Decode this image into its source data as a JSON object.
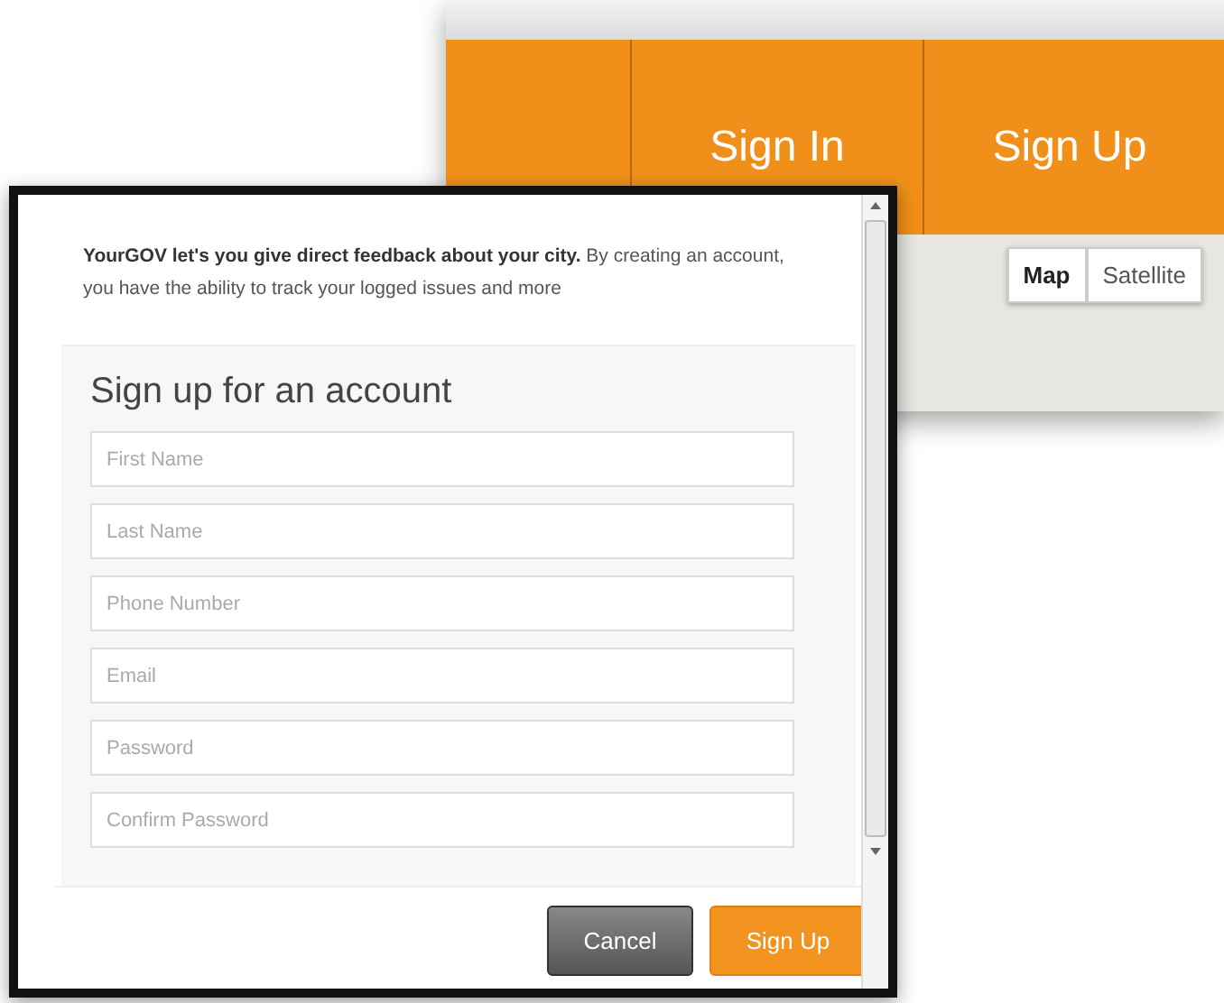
{
  "site_header": {
    "nav_items": [
      {
        "label": "Sign In"
      },
      {
        "label": "Sign Up"
      }
    ],
    "map_type": [
      {
        "label": "Map",
        "selected": true
      },
      {
        "label": "Satellite",
        "selected": false
      }
    ]
  },
  "dialog": {
    "intro": "**YourGOV let's you give direct feedback about your city.** By creating an account, you have the ability to track your logged issues and more",
    "title": "Sign up for an account",
    "fields": [
      {
        "placeholder": "First Name"
      },
      {
        "placeholder": "Last Name"
      },
      {
        "placeholder": "Phone Number"
      },
      {
        "placeholder": "Email"
      },
      {
        "placeholder": "Password"
      },
      {
        "placeholder": "Confirm Password"
      }
    ],
    "buttons": [
      {
        "label": "Cancel",
        "kind": "secondary"
      },
      {
        "label": "Sign Up",
        "kind": "primary"
      }
    ]
  }
}
